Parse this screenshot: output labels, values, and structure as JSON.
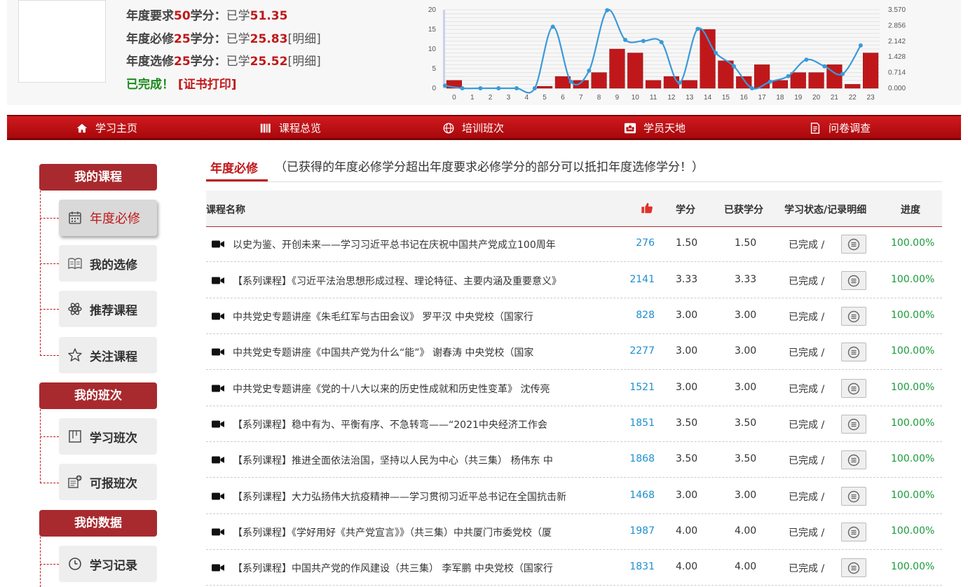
{
  "stats": {
    "yearly": {
      "label": "年度要求",
      "req": "50",
      "unit": "学分：",
      "learned_label": "已学",
      "learned": "51.35"
    },
    "required": {
      "label": "年度必修",
      "req": "25",
      "unit": "学分：",
      "learned_label": "已学",
      "learned": "25.83",
      "detail": "[明细]"
    },
    "elective": {
      "label": "年度选修",
      "req": "25",
      "unit": "学分：",
      "learned_label": "已学",
      "learned": "25.52",
      "detail": "[明细]"
    },
    "done_text": "已完成！",
    "cert_text": "[证书打印]"
  },
  "chart_data": {
    "type": "bar+line",
    "x": [
      "0",
      "1",
      "2",
      "3",
      "4",
      "5",
      "6",
      "7",
      "8",
      "9",
      "10",
      "11",
      "12",
      "13",
      "14",
      "15",
      "16",
      "17",
      "18",
      "19",
      "20",
      "21",
      "22",
      "23"
    ],
    "bar_values": [
      2,
      0,
      0,
      0,
      0,
      0.5,
      3,
      2,
      4,
      10,
      9,
      2,
      3,
      2,
      15,
      7,
      3,
      6,
      2,
      4,
      4,
      6,
      1,
      9
    ],
    "line_values": [
      0.12,
      0.0,
      0.0,
      0.0,
      0.0,
      0.0,
      2.8,
      0.3,
      0.8,
      3.55,
      2.2,
      2.15,
      2.1,
      0.25,
      2.7,
      1.6,
      1.0,
      0.0,
      0.3,
      0.55,
      1.3,
      1.0,
      0.65,
      1.95
    ],
    "yleft_ticks": [
      "0",
      "5",
      "10",
      "15",
      "20"
    ],
    "yleft_lim": [
      0,
      20
    ],
    "yright_ticks": [
      "0.000",
      "0.714",
      "1.428",
      "2.142",
      "2.856",
      "3.570"
    ],
    "yright_lim": [
      0,
      3.57
    ],
    "bar_color": "#c0181a",
    "line_color": "#3a9ad9"
  },
  "nav": [
    {
      "label": "学习主页",
      "icon": "home-icon"
    },
    {
      "label": "课程总览",
      "icon": "books-icon"
    },
    {
      "label": "培训班次",
      "icon": "globe-icon"
    },
    {
      "label": "学员天地",
      "icon": "people-icon"
    },
    {
      "label": "问卷调查",
      "icon": "survey-icon"
    }
  ],
  "sidebar": {
    "sections": [
      {
        "title": "我的课程",
        "items": [
          {
            "label": "年度必修",
            "icon": "calendar-icon"
          },
          {
            "label": "我的选修",
            "icon": "book-icon"
          },
          {
            "label": "推荐课程",
            "icon": "atom-icon"
          },
          {
            "label": "关注课程",
            "icon": "star-icon"
          }
        ]
      },
      {
        "title": "我的班次",
        "items": [
          {
            "label": "学习班次",
            "icon": "board-icon"
          },
          {
            "label": "可报班次",
            "icon": "enroll-icon"
          }
        ]
      },
      {
        "title": "我的数据",
        "items": [
          {
            "label": "学习记录",
            "icon": "clock-icon"
          }
        ]
      }
    ]
  },
  "tab": {
    "title": "年度必修",
    "note": "（已获得的年度必修学分超出年度要求必修学分的部分可以抵扣年度选修学分！）"
  },
  "table": {
    "headers": {
      "name": "课程名称",
      "credit": "学分",
      "got": "已获学分",
      "status": "学习状态/记录明细",
      "progress": "进度"
    },
    "rows": [
      {
        "name": "以史为鉴、开创未来——学习习近平总书记在庆祝中国共产党成立100周年",
        "likes": "276",
        "credit": "1.50",
        "got": "1.50",
        "status": "已完成 /",
        "progress": "100.00%"
      },
      {
        "name": "【系列课程】《习近平法治思想形成过程、理论特征、主要内涵及重要意义》",
        "likes": "2141",
        "credit": "3.33",
        "got": "3.33",
        "status": "已完成 /",
        "progress": "100.00%"
      },
      {
        "name": "中共党史专题讲座《朱毛红军与古田会议》 罗平汉 中央党校（国家行",
        "likes": "828",
        "credit": "3.00",
        "got": "3.00",
        "status": "已完成 /",
        "progress": "100.00%"
      },
      {
        "name": "中共党史专题讲座《中国共产党为什么“能”》 谢春涛 中央党校（国家",
        "likes": "2277",
        "credit": "3.00",
        "got": "3.00",
        "status": "已完成 /",
        "progress": "100.00%"
      },
      {
        "name": "中共党史专题讲座《党的十八大以来的历史性成就和历史性变革》 沈传亮",
        "likes": "1521",
        "credit": "3.00",
        "got": "3.00",
        "status": "已完成 /",
        "progress": "100.00%"
      },
      {
        "name": "【系列课程】稳中有为、平衡有序、不急转弯——“2021中央经济工作会",
        "likes": "1851",
        "credit": "3.50",
        "got": "3.50",
        "status": "已完成 /",
        "progress": "100.00%"
      },
      {
        "name": "【系列课程】推进全面依法治国，坚持以人民为中心（共三集） 杨伟东 中",
        "likes": "1868",
        "credit": "3.50",
        "got": "3.50",
        "status": "已完成 /",
        "progress": "100.00%"
      },
      {
        "name": "【系列课程】大力弘扬伟大抗疫精神——学习贯彻习近平总书记在全国抗击新",
        "likes": "1468",
        "credit": "3.00",
        "got": "3.00",
        "status": "已完成 /",
        "progress": "100.00%"
      },
      {
        "name": "【系列课程】《学好用好《共产党宣言》》（共三集）中共厦门市委党校（厦",
        "likes": "1987",
        "credit": "4.00",
        "got": "4.00",
        "status": "已完成 /",
        "progress": "100.00%"
      },
      {
        "name": "【系列课程】中国共产党的作风建设（共三集） 李军鹏 中央党校（国家行",
        "likes": "1831",
        "credit": "4.00",
        "got": "4.00",
        "status": "已完成 /",
        "progress": "100.00%"
      }
    ]
  }
}
